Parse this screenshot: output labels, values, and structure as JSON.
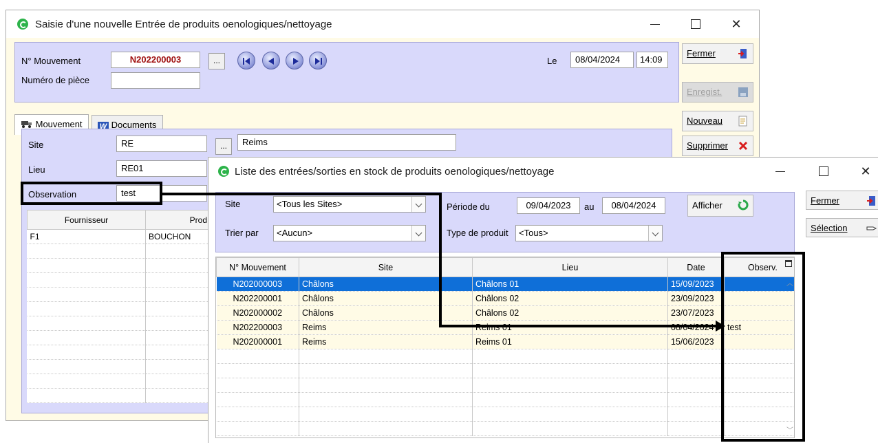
{
  "back_window": {
    "title": "Saisie d'une nouvelle  Entrée  de produits oenologiques/nettoyage",
    "header": {
      "no_mouvement_label": "N° Mouvement",
      "no_mouvement_value": "N202200003",
      "numero_piece_label": "Numéro de pièce",
      "numero_piece_value": "",
      "lookup_button": "...",
      "le_label": "Le",
      "date_value": "08/04/2024",
      "time_value": "14:09"
    },
    "tabs": [
      {
        "label": "Mouvement"
      },
      {
        "label": "Documents"
      }
    ],
    "form": {
      "site_label": "Site",
      "site_code": "RE",
      "site_lookup": "...",
      "site_name": "Reims",
      "lieu_label": "Lieu",
      "lieu_code": "RE01",
      "observation_label": "Observation",
      "observation_value": "test"
    },
    "grid": {
      "columns": [
        "Fournisseur",
        "Prod"
      ],
      "rows": [
        [
          "F1",
          "BOUCHON"
        ]
      ]
    },
    "buttons": {
      "fermer": "Fermer",
      "enregist": "Enregist.",
      "nouveau": "Nouveau",
      "supprimer": "Supprimer"
    }
  },
  "front_window": {
    "title": "Liste des entrées/sorties en stock de produits oenologiques/nettoyage",
    "filters": {
      "site_label": "Site",
      "site_value": "<Tous les Sites>",
      "trier_label": "Trier par",
      "trier_value": "<Aucun>",
      "periode_label": "Période du",
      "periode_from": "09/04/2023",
      "au_label": "au",
      "periode_to": "08/04/2024",
      "type_label": "Type de produit",
      "type_value": "<Tous>",
      "afficher": "Afficher"
    },
    "table": {
      "columns": [
        "N° Mouvement",
        "Site",
        "Lieu",
        "Date",
        "Observ."
      ],
      "rows": [
        {
          "num": "N202000003",
          "site": "Châlons",
          "lieu": "Châlons 01",
          "date": "15/09/2023",
          "obs": ""
        },
        {
          "num": "N202200001",
          "site": "Châlons",
          "lieu": "Châlons 02",
          "date": "23/09/2023",
          "obs": ""
        },
        {
          "num": "N202000002",
          "site": "Châlons",
          "lieu": "Châlons 02",
          "date": "23/07/2023",
          "obs": ""
        },
        {
          "num": "N202200003",
          "site": "Reims",
          "lieu": "Reims 01",
          "date": "08/04/2024",
          "obs": "test"
        },
        {
          "num": "N202000001",
          "site": "Reims",
          "lieu": "Reims 01",
          "date": "15/06/2023",
          "obs": ""
        }
      ]
    },
    "buttons": {
      "fermer": "Fermer",
      "selection": "Sélection"
    }
  },
  "colors": {
    "panel": "#d9d9fb",
    "selected_row": "#0f6fd8",
    "mouvement_red": "#a01010",
    "app_icon": "#2db34a"
  }
}
